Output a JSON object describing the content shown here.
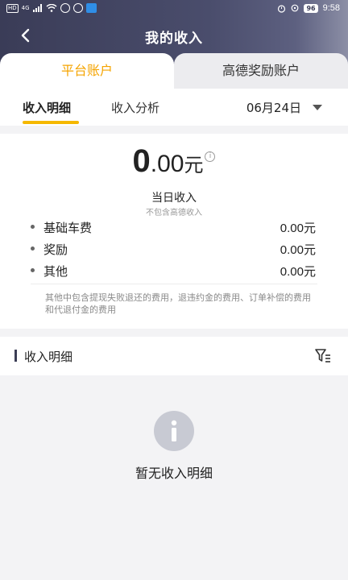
{
  "status_bar": {
    "left_chip": "HD",
    "network": "4G",
    "battery": "96",
    "time": "9:58"
  },
  "header": {
    "title": "我的收入"
  },
  "account_tabs": {
    "platform": "平台账户",
    "gaode_reward": "高德奖励账户"
  },
  "sub_tabs": {
    "detail": "收入明细",
    "analysis": "收入分析",
    "date": "06月24日"
  },
  "summary": {
    "amount_int": "0",
    "amount_dec": ".00",
    "unit": "元",
    "label": "当日收入",
    "sublabel": "不包含高德收入",
    "items": [
      {
        "label": "基础车费",
        "value": "0.00元"
      },
      {
        "label": "奖励",
        "value": "0.00元"
      },
      {
        "label": "其他",
        "value": "0.00元"
      }
    ],
    "note": "其他中包含提现失败退还的费用，退违约金的费用、订单补偿的费用和代退付金的费用"
  },
  "details_section": {
    "title": "收入明细",
    "empty_text": "暂无收入明细"
  }
}
